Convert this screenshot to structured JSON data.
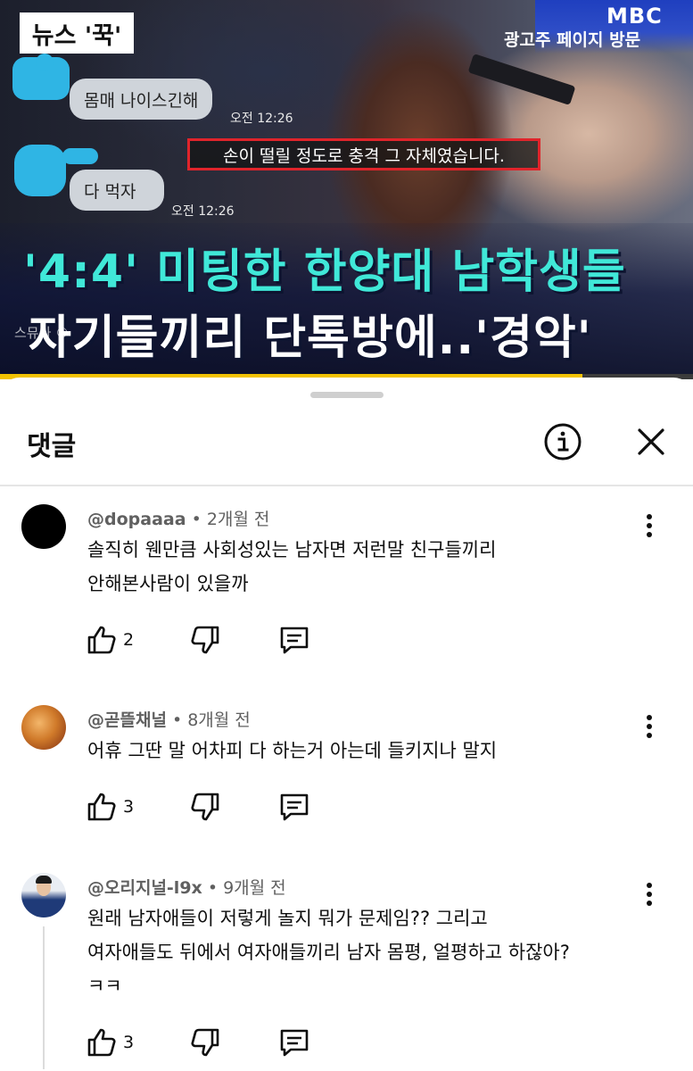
{
  "video": {
    "news_badge": "뉴스 '꾹'",
    "channel_logo": "MBC",
    "ad_visit_label": "광고주 페이지 방문",
    "chat": [
      {
        "text": "몸매 나이스긴해",
        "time": "오전 12:26"
      },
      {
        "text": "다   먹자",
        "time": "오전 12:26"
      }
    ],
    "quote": "손이 떨릴 정도로 충격 그 자체였습니다.",
    "headline_line1": "'4:4' 미팅한 한양대 남학생들",
    "headline_line2": "자기들끼리 단톡방에..'경악'",
    "watermark": "스뮤사 ©",
    "progress": 0.84
  },
  "sheet": {
    "title": "댓글",
    "info_icon": "info-icon",
    "close_icon": "close-icon"
  },
  "comments": [
    {
      "handle": "@dopaaaa",
      "time": "2개월 전",
      "text": "솔직히 웬만큼 사회성있는 남자면 저런말 친구들끼리\n안해본사람이 있을까",
      "likes": "2",
      "avatar": "black-circle"
    },
    {
      "handle": "@곧뜰채널",
      "time": "8개월 전",
      "text": "어휴 그딴 말 어차피 다 하는거 아는데 들키지나 말지",
      "likes": "3",
      "avatar": "fried-chicken"
    },
    {
      "handle": "@오리지널-l9x",
      "time": "9개월 전",
      "text": "원래 남자애들이 저렇게 놀지 뭐가 문제임?? 그리고\n여자애들도 뒤에서 여자애들끼리 남자 몸평, 얼평하고 하잖아?\nㅋㅋ",
      "likes": "3",
      "avatar": "man-in-suit"
    }
  ]
}
